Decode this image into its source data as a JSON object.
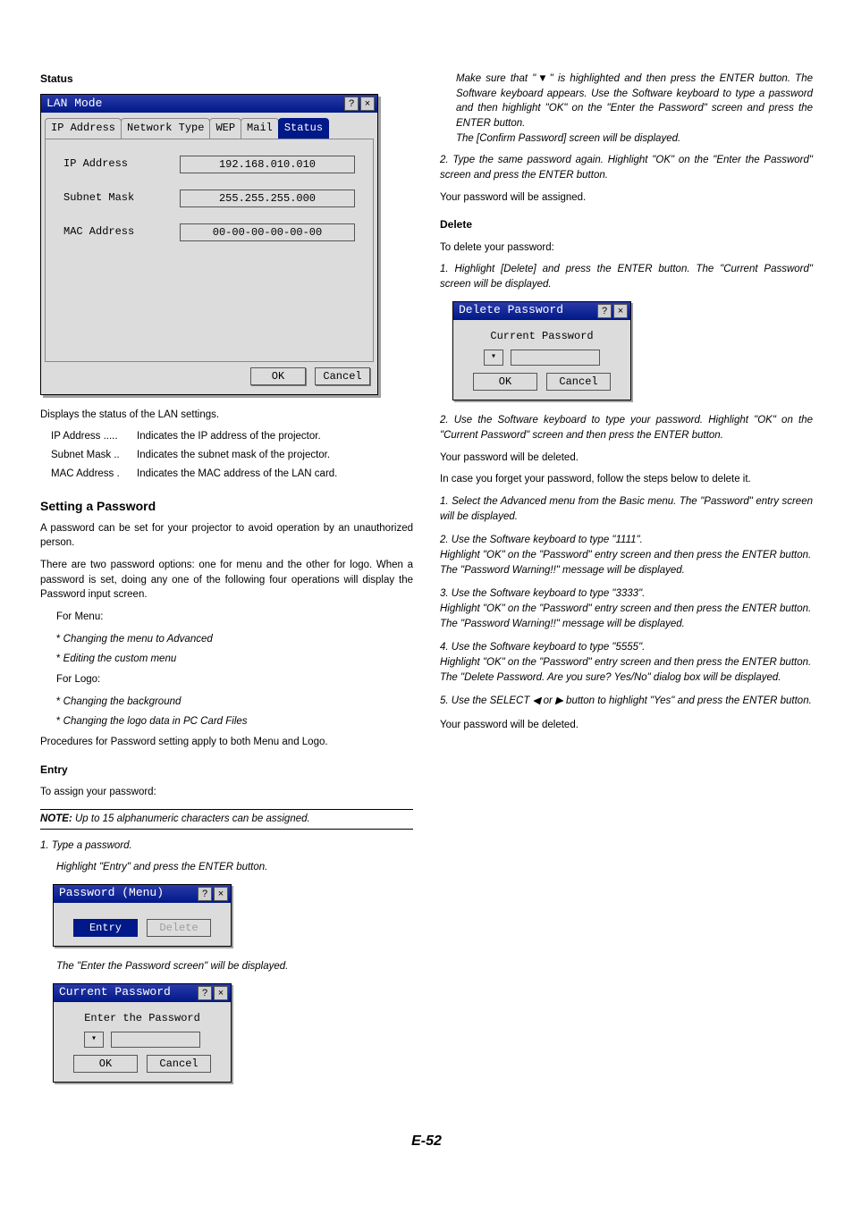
{
  "pagefoot": "E-52",
  "left": {
    "status_heading": "Status",
    "lan_dialog": {
      "title": "LAN Mode",
      "help_btn": "?",
      "close_btn": "×",
      "tabs": [
        "IP Address",
        "Network Type",
        "WEP",
        "Mail",
        "Status"
      ],
      "active_tab_index": 4,
      "fields": [
        {
          "label": "IP Address",
          "value": "192.168.010.010"
        },
        {
          "label": "Subnet Mask",
          "value": "255.255.255.000"
        },
        {
          "label": "MAC Address",
          "value": "00-00-00-00-00-00"
        }
      ],
      "ok": "OK",
      "cancel": "Cancel"
    },
    "status_desc": "Displays the status of the LAN settings.",
    "defs": [
      {
        "k": "IP Address .....",
        "v": "Indicates the IP address of the projector."
      },
      {
        "k": "Subnet Mask ..",
        "v": "Indicates the subnet mask of the projector."
      },
      {
        "k": "MAC Address .",
        "v": "Indicates the MAC address of the LAN card."
      }
    ],
    "setting_title": "Setting a Password",
    "setting_p1": "A password can be set for your projector to avoid operation by an unauthorized person.",
    "setting_p2": "There are two password options: one for menu and the other for logo. When a password is set, doing any one of the following four operations will display the Password input screen.",
    "formenu_label": "For Menu:",
    "formenu_items": [
      "Changing the menu to Advanced",
      "Editing the custom menu"
    ],
    "forlogo_label": "For Logo:",
    "forlogo_items": [
      "Changing the background",
      "Changing the logo data in PC Card Files"
    ],
    "proc_line": "Procedures for Password setting apply to both Menu and Logo.",
    "entry_heading": "Entry",
    "entry_sub": "To assign your password:",
    "note_label": "NOTE:",
    "note_text": " Up to 15 alphanumeric characters can be assigned.",
    "step1_a": "1. Type a password.",
    "step1_b": "Highlight \"Entry\" and press the ENTER button.",
    "pwd_dialog": {
      "title": "Password (Menu)",
      "entry_btn": "Entry",
      "delete_btn": "Delete"
    },
    "enter_screen_line": "The \"Enter the Password screen\" will be displayed.",
    "current_pwd_dialog": {
      "title": "Current Password",
      "label": "Enter the Password",
      "ok": "OK",
      "cancel": "Cancel"
    }
  },
  "right": {
    "top_block": "Make sure that \"▼\" is highlighted and then press the ENTER button. The Software keyboard appears. Use the Software keyboard to type a password and then highlight \"OK\" on the \"Enter the Password\" screen and press the ENTER button.\nThe [Confirm Password] screen will be displayed.",
    "step2": "2. Type the same password again. Highlight \"OK\" on the \"Enter the Password\" screen and press the ENTER button.",
    "assigned": "Your password will be assigned.",
    "delete_heading": "Delete",
    "delete_sub": "To delete your password:",
    "del_step1": "1. Highlight [Delete] and press the ENTER button. The \"Current Password\" screen will be displayed.",
    "delete_dialog": {
      "title": "Delete Password",
      "label": "Current Password",
      "ok": "OK",
      "cancel": "Cancel"
    },
    "del_step2": "2. Use the Software keyboard to type your password. Highlight \"OK\" on the \"Current Password\" screen and then press the ENTER button.",
    "deleted1": "Your password will be deleted.",
    "forget_intro": "In case you forget your password, follow the steps below to delete it.",
    "f_step1": "1. Select the Advanced menu from the Basic menu. The \"Password\" entry screen will be displayed.",
    "f_step2": "2. Use the Software keyboard to type \"1111\".\nHighlight \"OK\" on the \"Password\" entry screen and then press the ENTER button.\nThe \"Password Warning!!\" message will be displayed.",
    "f_step3": "3. Use the Software keyboard to type \"3333\".\nHighlight \"OK\" on the \"Password\" entry screen and then press the ENTER button.\nThe \"Password Warning!!\" message will be displayed.",
    "f_step4": "4. Use the Software keyboard to type \"5555\".\nHighlight \"OK\" on the \"Password\" entry screen and then press the ENTER button.\nThe \"Delete Password. Are you sure? Yes/No\" dialog box will be displayed.",
    "f_step5": "5. Use the SELECT ◀ or ▶ button to highlight \"Yes\" and press the ENTER button.",
    "deleted2": "Your password will be deleted."
  }
}
